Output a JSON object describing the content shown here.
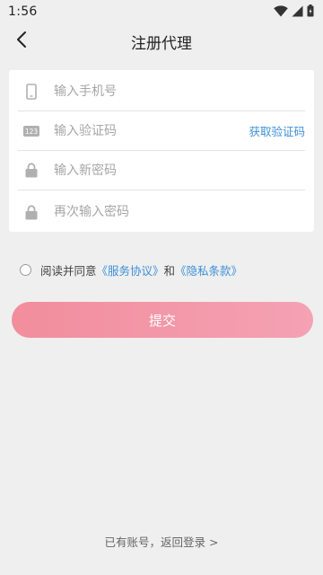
{
  "status_bar": {
    "time": "1:56",
    "icons": [
      "wifi-icon",
      "signal-icon",
      "battery-icon"
    ]
  },
  "nav": {
    "back_icon": "chevron-left-icon",
    "title": "注册代理"
  },
  "form": {
    "phone": {
      "placeholder": "输入手机号",
      "icon": "phone-icon"
    },
    "code": {
      "placeholder": "输入验证码",
      "icon": "code-123-icon",
      "action_label": "获取验证码"
    },
    "password": {
      "placeholder": "输入新密码",
      "icon": "lock-icon"
    },
    "confirm_password": {
      "placeholder": "再次输入密码",
      "icon": "lock-icon"
    }
  },
  "agreement": {
    "prefix": "阅读并同意",
    "service_link": "《服务协议》",
    "conjunction": "和",
    "privacy_link": "《隐私条款》",
    "checked": false
  },
  "submit_label": "提交",
  "footer_link": "已有账号，返回登录 >",
  "colors": {
    "background": "#efefef",
    "link": "#3d8fd6",
    "button_start": "#f28d9c",
    "button_end": "#f4a2b4"
  }
}
